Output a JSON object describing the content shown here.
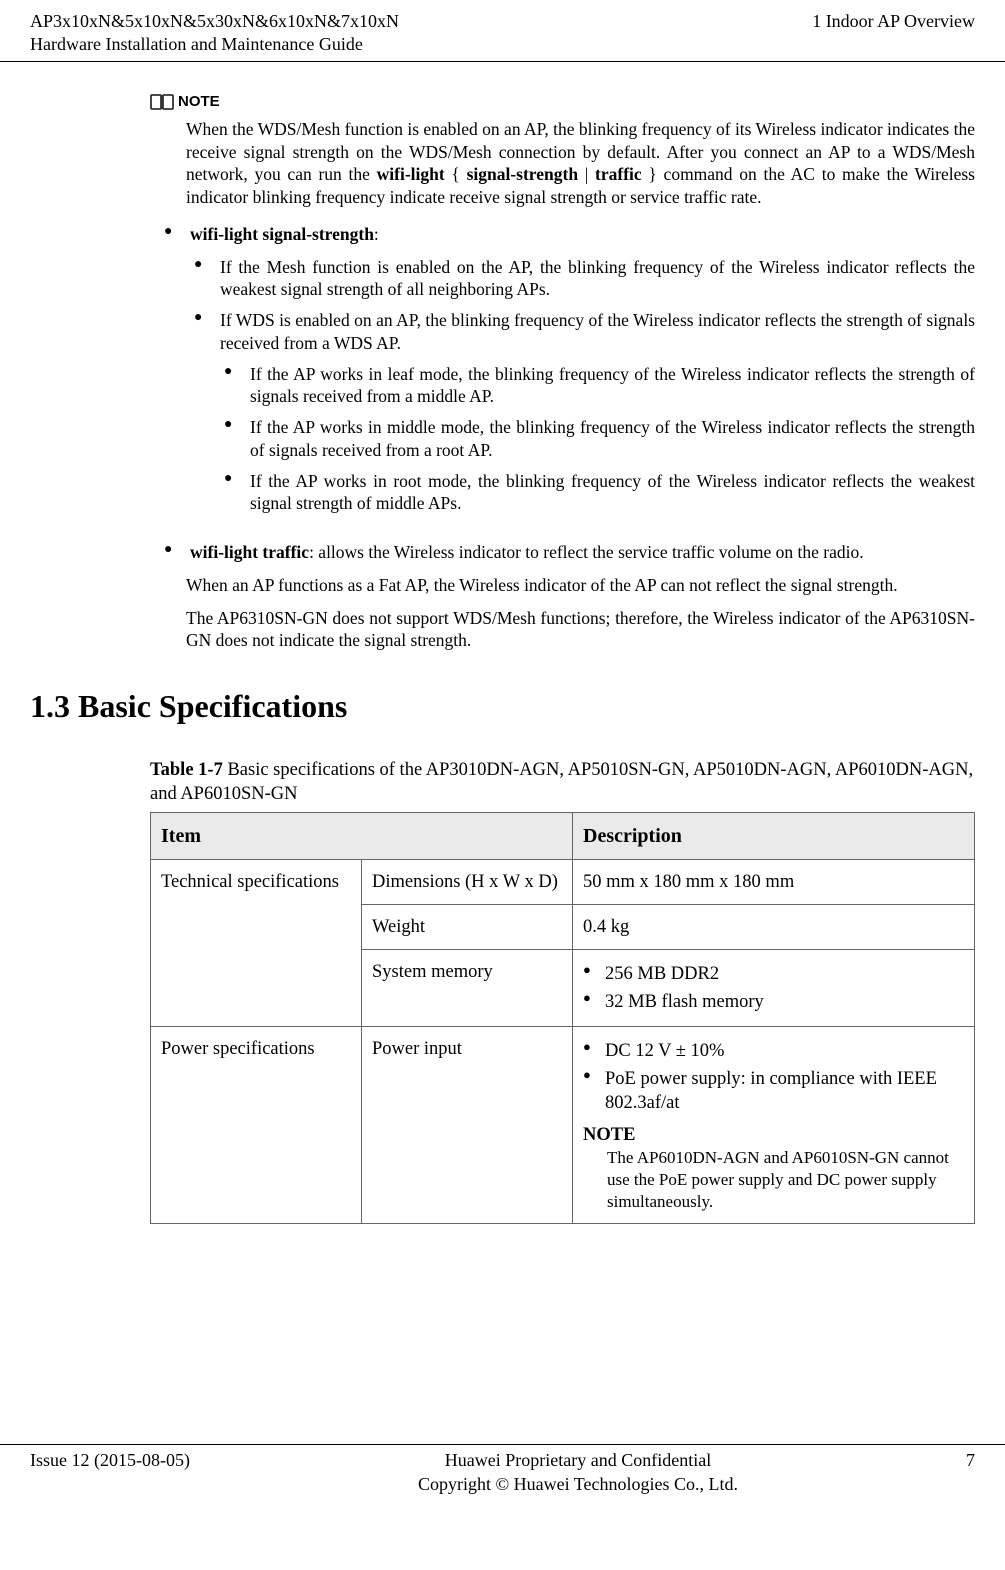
{
  "header": {
    "product_line": "AP3x10xN&5x10xN&5x30xN&6x10xN&7x10xN",
    "doc_title": "Hardware Installation and Maintenance Guide",
    "chapter": "1 Indoor AP Overview"
  },
  "note_label": "NOTE",
  "note_intro_pre": "When the WDS/Mesh function is enabled on an AP, the blinking frequency of its Wireless indicator indicates the receive signal strength on the WDS/Mesh connection by default. After you connect an AP to a WDS/Mesh network, you can run the ",
  "note_intro_cmd1": "wifi-light",
  "note_intro_brace_open": " { ",
  "note_intro_cmd2": "signal-strength",
  "note_intro_pipe": " | ",
  "note_intro_cmd3": "traffic",
  "note_intro_brace_close": " } ",
  "note_intro_post": "command on the AC to make the Wireless indicator blinking frequency indicate receive signal strength or service traffic rate.",
  "b1_label": "wifi-light signal-strength",
  "b1_suffix": ":",
  "b1_s1": "If the Mesh function is enabled on the AP, the blinking frequency of the Wireless indicator reflects the weakest signal strength of all neighboring APs.",
  "b1_s2": "If WDS is enabled on an AP, the blinking frequency of the Wireless indicator reflects the strength of signals received from a WDS AP.",
  "b1_s2_a": "If the AP works in leaf mode, the blinking frequency of the Wireless indicator reflects the strength of signals received from a middle AP.",
  "b1_s2_b": "If the AP works in middle mode, the blinking frequency of the Wireless indicator reflects the strength of signals received from a root AP.",
  "b1_s2_c": "If the AP works in root mode, the blinking frequency of the Wireless indicator reflects the weakest signal strength of middle APs.",
  "b2_label": "wifi-light traffic",
  "b2_text": ": allows the Wireless indicator to reflect the service traffic volume on the radio.",
  "para1": "When an AP functions as a Fat AP, the Wireless indicator of the AP can not reflect the signal strength.",
  "para2": "The AP6310SN-GN does not support WDS/Mesh functions; therefore, the Wireless indicator of the AP6310SN-GN does not indicate the signal strength.",
  "section_title": "1.3 Basic Specifications",
  "table_caption_bold": "Table 1-7",
  "table_caption_text": " Basic specifications of the AP3010DN-AGN, AP5010SN-GN, AP5010DN-AGN, AP6010DN-AGN, and AP6010SN-GN",
  "th_item": "Item",
  "th_desc": "Description",
  "r1c1": "Technical specifications",
  "r1c2": "Dimensions (H x W x D)",
  "r1c3": "50 mm x 180 mm x 180 mm",
  "r2c2": "Weight",
  "r2c3": "0.4 kg",
  "r3c2": "System memory",
  "r3c3_li1": "256 MB DDR2",
  "r3c3_li2": "32 MB flash memory",
  "r4c1": "Power specifications",
  "r4c2": "Power input",
  "r4c3_li1": "DC 12 V ± 10%",
  "r4c3_li2": "PoE power supply: in compliance with IEEE 802.3af/at",
  "r4c3_note_label": "NOTE",
  "r4c3_note": "The AP6010DN-AGN and AP6010SN-GN cannot use the PoE power supply and DC power supply simultaneously.",
  "footer": {
    "issue": "Issue 12 (2015-08-05)",
    "conf": "Huawei Proprietary and Confidential",
    "copy": "Copyright © Huawei Technologies Co., Ltd.",
    "page": "7"
  }
}
